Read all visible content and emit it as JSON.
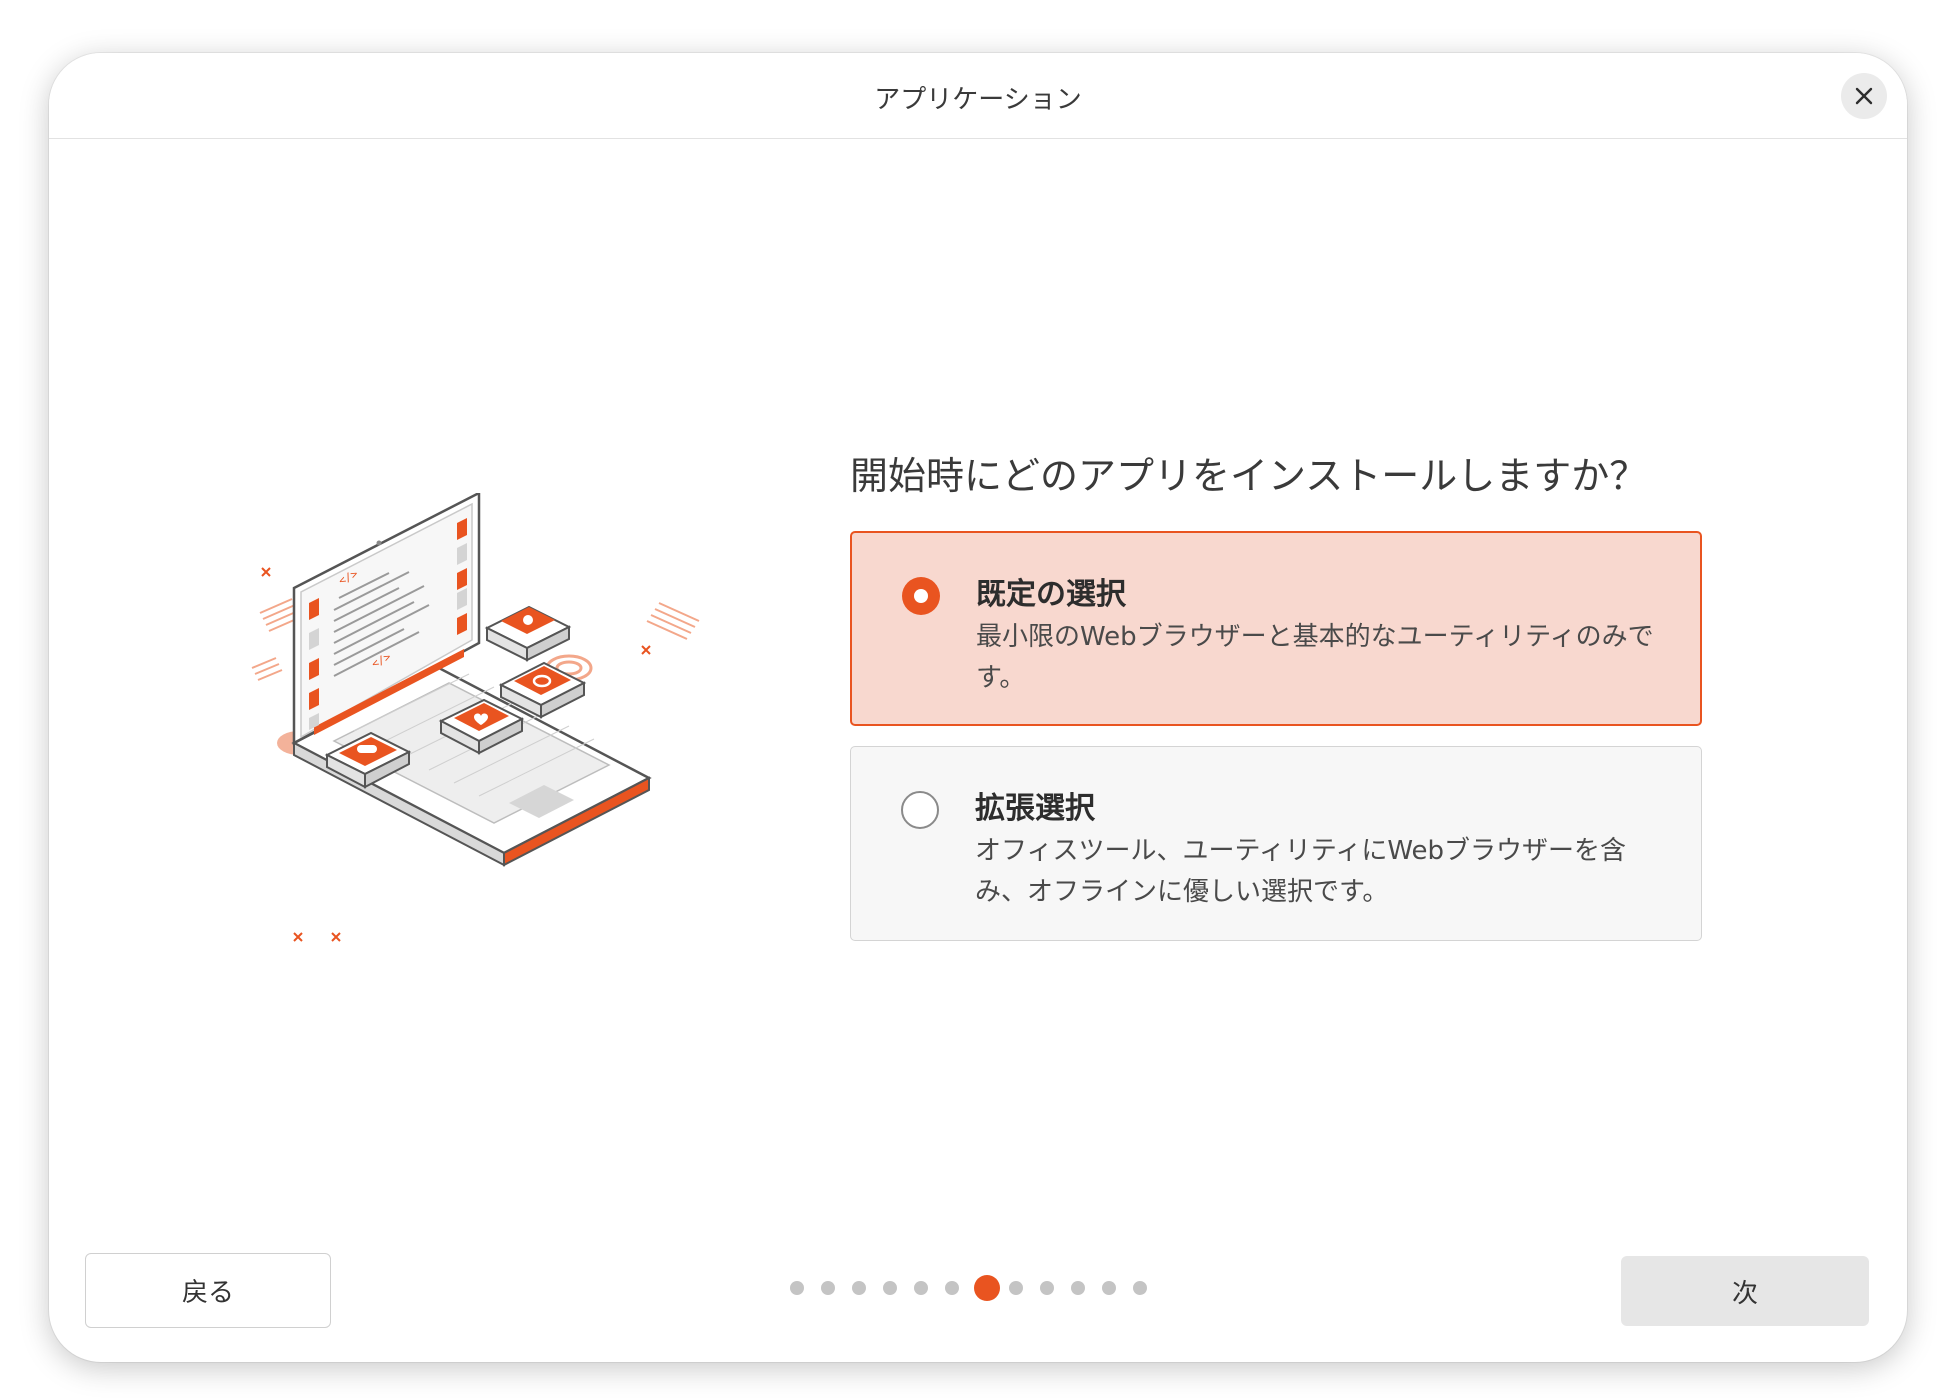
{
  "window": {
    "title": "アプリケーション",
    "close_icon": "close-icon"
  },
  "main": {
    "question": "開始時にどのアプリをインストールしますか？",
    "options": [
      {
        "title": "既定の選択",
        "description": "最小限のWebブラウザーと基本的なユーティリティのみです。",
        "selected": true
      },
      {
        "title": "拡張選択",
        "description": "オフィスツール、ユーティリティにWebブラウザーを含み、オフラインに優しい選択です。",
        "selected": false
      }
    ]
  },
  "footer": {
    "back_label": "戻る",
    "next_label": "次",
    "pager": {
      "total_steps": 12,
      "current_step": 7
    }
  },
  "colors": {
    "accent": "#e95420",
    "selected_bg": "#f8d8cf",
    "unselected_bg": "#f7f7f7"
  }
}
